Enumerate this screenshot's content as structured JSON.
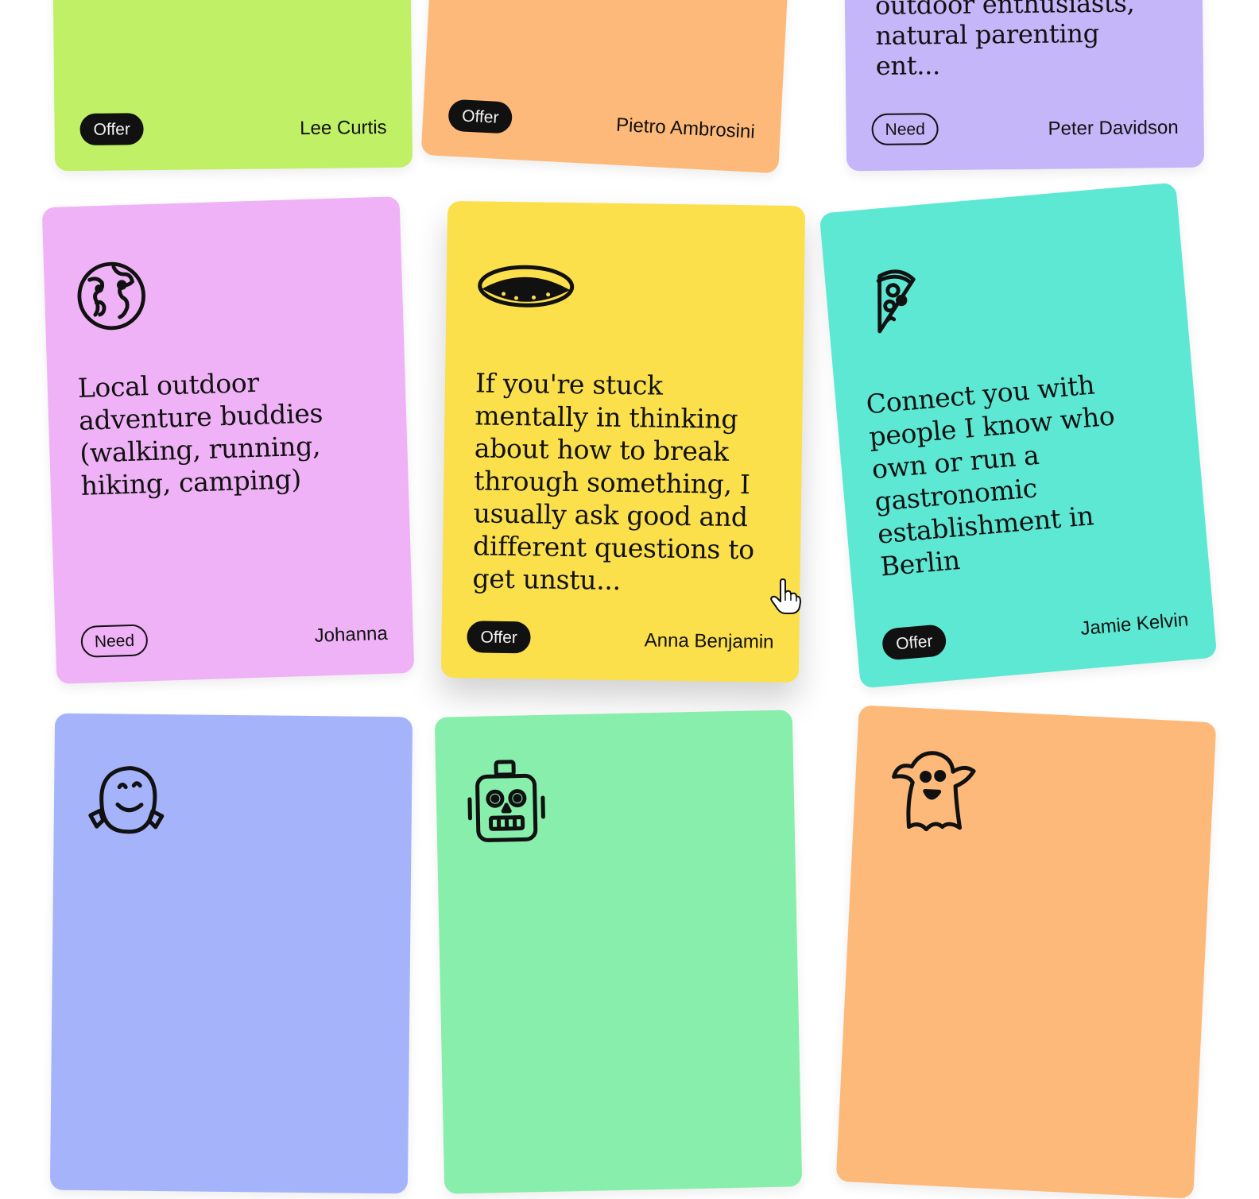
{
  "cards": [
    {
      "color": "#c0f066",
      "text": "",
      "tag": "Offer",
      "author": "Lee Curtis"
    },
    {
      "color": "#fdb97a",
      "text": "",
      "tag": "Offer",
      "author": "Pietro Ambrosini"
    },
    {
      "color": "#c4b6f8",
      "text": "outdoor enthusiasts, natural parenting ent...",
      "tag": "Need",
      "author": "Peter Davidson"
    },
    {
      "color": "#efb2f6",
      "icon": "globe-icon",
      "text": "Local outdoor adventure buddies (walking, running, hiking, camping)",
      "tag": "Need",
      "author": "Johanna"
    },
    {
      "color": "#fbe04c",
      "icon": "hole-icon",
      "text": "If you're stuck mentally in thinking about how to break through something, I usually ask good and different questions to get unstu...",
      "tag": "Offer",
      "author": "Anna Benjamin"
    },
    {
      "color": "#5de8d4",
      "icon": "pizza-icon",
      "text": "Connect you with people I know who own or run a gastronomic establishment in Berlin",
      "tag": "Offer",
      "author": "Jamie Kelvin"
    },
    {
      "color": "#a5b4fa",
      "icon": "happy-face-icon",
      "text": "",
      "tag": "",
      "author": ""
    },
    {
      "color": "#88eeab",
      "icon": "robot-icon",
      "text": "",
      "tag": "",
      "author": ""
    },
    {
      "color": "#fdb97a",
      "icon": "ghost-icon",
      "text": "",
      "tag": "",
      "author": ""
    }
  ],
  "cursor_icon": "pointer-hand-icon"
}
